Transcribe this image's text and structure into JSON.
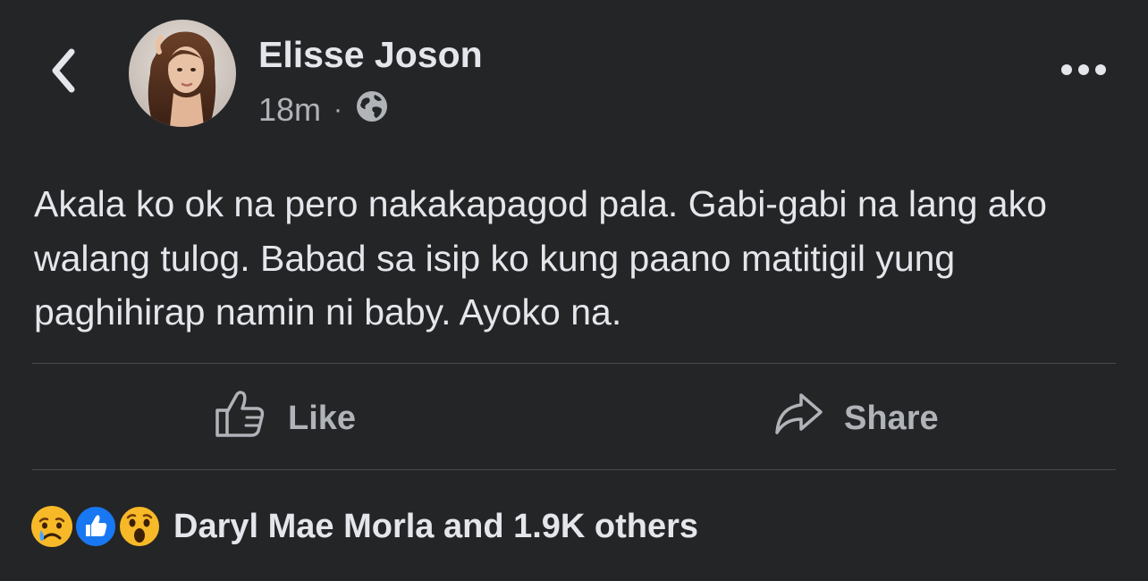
{
  "header": {
    "author_name": "Elisse Joson",
    "timestamp": "18m",
    "separator": "·",
    "icons": {
      "back": "chevron-left-icon",
      "privacy": "globe-icon",
      "more": "more-horizontal-icon"
    }
  },
  "post": {
    "text": "Akala ko ok na pero nakakapagod pala. Gabi-gabi na lang ako walang tulog. Babad sa isip ko kung paano matitigil yung paghihirap namin ni baby. Ayoko na."
  },
  "actions": {
    "like_label": "Like",
    "share_label": "Share"
  },
  "reactions": {
    "summary": "Daryl Mae Morla and 1.9K others",
    "types": [
      "sad",
      "like",
      "wow"
    ]
  },
  "colors": {
    "background": "#242526",
    "primary_text": "#e4e6eb",
    "secondary_text": "#b0b3b8",
    "divider": "#4a4b4d",
    "like_blue": "#1877f2",
    "emoji_yellow": "#f7b928"
  }
}
